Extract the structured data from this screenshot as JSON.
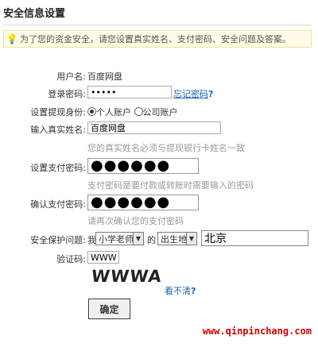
{
  "page_title": "安全信息设置",
  "notice": {
    "icon": "bulb-icon",
    "text": "为了您的资金安全，请您设置真实姓名、支付密码、安全问题及答案。"
  },
  "form": {
    "username": {
      "label": "用户名:",
      "value": "百度网盘"
    },
    "login_password": {
      "label": "登录密码:",
      "value": "•••••",
      "forgot_link": "忘记密码",
      "forgot_q": "?"
    },
    "withdraw_identity": {
      "label": "设置提现身份:",
      "options": [
        "个人账户",
        "公司账户"
      ],
      "selected": "个人账户"
    },
    "real_name": {
      "label": "输入真实姓名:",
      "value": "百度网盘",
      "help": "您的真实姓名必须与提现银行卡姓名一致"
    },
    "pay_password": {
      "label": "设置支付密码:",
      "value": "●●●●●●",
      "help": "支付密码是要付款或转账时需要输入的密码"
    },
    "confirm_pay_password": {
      "label": "确认支付密码:",
      "value": "●●●●●●",
      "help": "请再次确认您的支付密码"
    },
    "security_question": {
      "label": "安全保护问题:",
      "prefix": "我",
      "select1": "小学老师",
      "middle": "的",
      "select2": "出生地",
      "answer": "北京"
    },
    "captcha": {
      "label": "验证码:",
      "value": "WWWA",
      "image_text": "WWWA",
      "refresh_link": "看不清",
      "refresh_q": "?"
    },
    "submit_label": "确定"
  },
  "watermark": "www.qinpinchang.com",
  "colors": {
    "link": "#1a5fb4",
    "watermark": "#d40000",
    "notice_bg": "#fffbe6"
  }
}
